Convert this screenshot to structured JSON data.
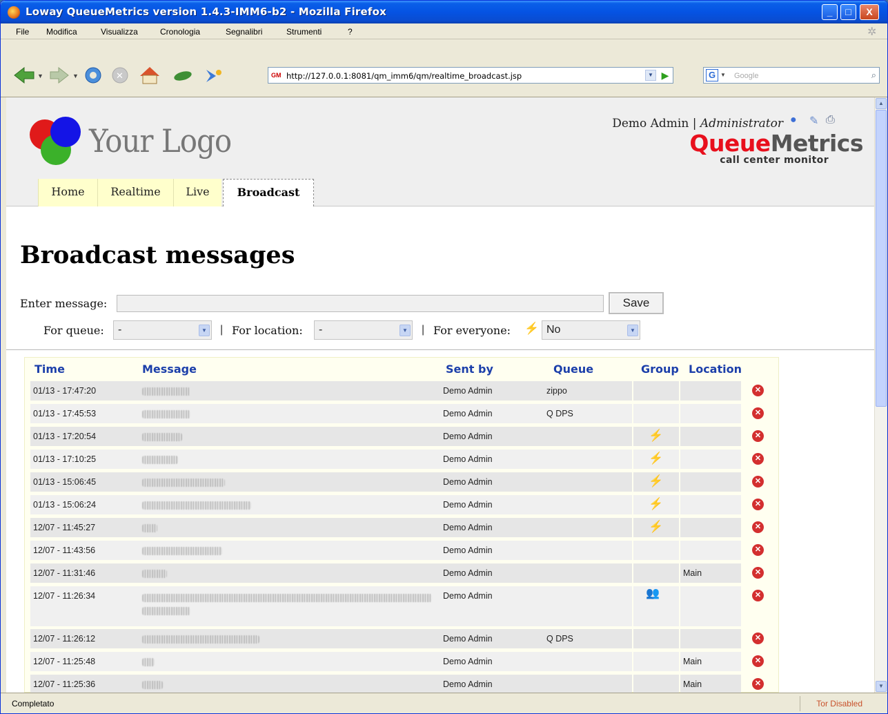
{
  "window": {
    "title": "Loway QueueMetrics version 1.4.3-IMM6-b2 - Mozilla Firefox",
    "controls": [
      "_",
      "□",
      "X"
    ]
  },
  "menu": [
    "File",
    "Modifica",
    "Visualizza",
    "Cronologia",
    "Segnalibri",
    "Strumenti",
    "?"
  ],
  "navbar": {
    "url": "http://127.0.0.1:8081/qm_imm6/qm/realtime_broadcast.jsp",
    "url_favicon": "GM",
    "search_engine": "G",
    "search_placeholder": "Google"
  },
  "header": {
    "logo_text": "Your Logo",
    "user": "Demo Admin",
    "separator": "|",
    "role": "Administrator",
    "brand_red": "Queue",
    "brand_gray": "Metrics",
    "brand_sub": "call center monitor",
    "icons": [
      "info-icon",
      "edit-icon",
      "printer-icon"
    ]
  },
  "tabs": [
    {
      "label": "Home",
      "active": false
    },
    {
      "label": "Realtime",
      "active": false
    },
    {
      "label": "Live",
      "active": false
    },
    {
      "label": "Broadcast",
      "active": true
    }
  ],
  "page": {
    "title": "Broadcast messages",
    "enter_message_label": "Enter message:",
    "message_value": "",
    "save_label": "Save",
    "for_queue_label": "For queue:",
    "for_queue_value": "-",
    "for_location_label": "For location:",
    "for_location_value": "-",
    "for_everyone_label": "For everyone:",
    "for_everyone_value": "No",
    "pipe": "|"
  },
  "table": {
    "headers": [
      "Time",
      "Message",
      "Sent by",
      "Queue",
      "Group",
      "Location"
    ],
    "rows": [
      {
        "time": "01/13 - 17:47:20",
        "sent_by": "Demo Admin",
        "queue": "zippo",
        "group": "",
        "location": ""
      },
      {
        "time": "01/13 - 17:45:53",
        "sent_by": "Demo Admin",
        "queue": "Q DPS",
        "group": "",
        "location": ""
      },
      {
        "time": "01/13 - 17:20:54",
        "sent_by": "Demo Admin",
        "queue": "",
        "group": "everyone",
        "location": ""
      },
      {
        "time": "01/13 - 17:10:25",
        "sent_by": "Demo Admin",
        "queue": "",
        "group": "everyone",
        "location": ""
      },
      {
        "time": "01/13 - 15:06:45",
        "sent_by": "Demo Admin",
        "queue": "",
        "group": "everyone",
        "location": ""
      },
      {
        "time": "01/13 - 15:06:24",
        "sent_by": "Demo Admin",
        "queue": "",
        "group": "everyone",
        "location": ""
      },
      {
        "time": "12/07 - 11:45:27",
        "sent_by": "Demo Admin",
        "queue": "",
        "group": "everyone",
        "location": ""
      },
      {
        "time": "12/07 - 11:43:56",
        "sent_by": "Demo Admin",
        "queue": "",
        "group": "",
        "location": ""
      },
      {
        "time": "12/07 - 11:31:46",
        "sent_by": "Demo Admin",
        "queue": "",
        "group": "",
        "location": "Main"
      },
      {
        "time": "12/07 - 11:26:34",
        "sent_by": "Demo Admin",
        "queue": "",
        "group": "group",
        "location": ""
      },
      {
        "time": "12/07 - 11:26:12",
        "sent_by": "Demo Admin",
        "queue": "Q DPS",
        "group": "",
        "location": ""
      },
      {
        "time": "12/07 - 11:25:48",
        "sent_by": "Demo Admin",
        "queue": "",
        "group": "",
        "location": "Main"
      },
      {
        "time": "12/07 - 11:25:36",
        "sent_by": "Demo Admin",
        "queue": "",
        "group": "",
        "location": "Main"
      }
    ]
  },
  "status": {
    "left": "Completato",
    "right": "Tor Disabled"
  },
  "colors": {
    "brand_red": "#e8101d",
    "link_blue": "#1c3faa",
    "tab_yellow": "#ffffcc",
    "delete_red": "#d32f2f"
  }
}
